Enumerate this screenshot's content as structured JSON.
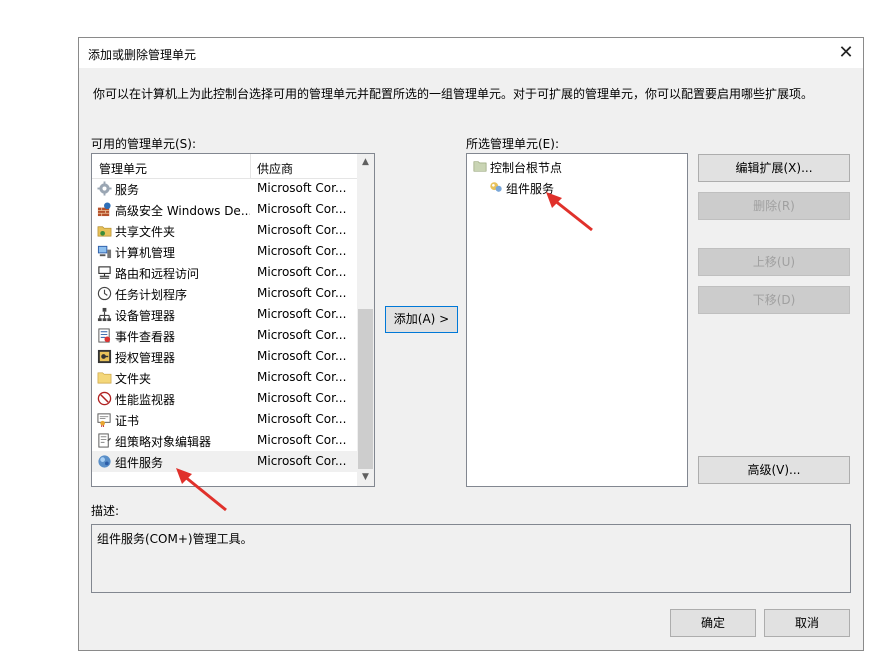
{
  "dialog": {
    "title": "添加或删除管理单元",
    "close_glyph": "✕",
    "intro": "你可以在计算机上为此控制台选择可用的管理单元并配置所选的一组管理单元。对于可扩展的管理单元，你可以配置要启用哪些扩展项。"
  },
  "available": {
    "label": "可用的管理单元(S):",
    "col_name": "管理单元",
    "col_vendor": "供应商",
    "items": [
      {
        "name": "服务",
        "vendor": "Microsoft Cor...",
        "icon": "gear-icon"
      },
      {
        "name": "高级安全 Windows De...",
        "vendor": "Microsoft Cor...",
        "icon": "firewall-icon"
      },
      {
        "name": "共享文件夹",
        "vendor": "Microsoft Cor...",
        "icon": "shared-folder-icon"
      },
      {
        "name": "计算机管理",
        "vendor": "Microsoft Cor...",
        "icon": "computer-management-icon"
      },
      {
        "name": "路由和远程访问",
        "vendor": "Microsoft Cor...",
        "icon": "routing-icon"
      },
      {
        "name": "任务计划程序",
        "vendor": "Microsoft Cor...",
        "icon": "clock-icon"
      },
      {
        "name": "设备管理器",
        "vendor": "Microsoft Cor...",
        "icon": "device-manager-icon"
      },
      {
        "name": "事件查看器",
        "vendor": "Microsoft Cor...",
        "icon": "event-viewer-icon"
      },
      {
        "name": "授权管理器",
        "vendor": "Microsoft Cor...",
        "icon": "authorization-icon"
      },
      {
        "name": "文件夹",
        "vendor": "Microsoft Cor...",
        "icon": "folder-icon"
      },
      {
        "name": "性能监视器",
        "vendor": "Microsoft Cor...",
        "icon": "performance-icon"
      },
      {
        "name": "证书",
        "vendor": "Microsoft Cor...",
        "icon": "certificate-icon"
      },
      {
        "name": "组策略对象编辑器",
        "vendor": "Microsoft Cor...",
        "icon": "group-policy-icon"
      },
      {
        "name": "组件服务",
        "vendor": "Microsoft Cor...",
        "icon": "component-services-icon"
      }
    ]
  },
  "add_button": "添加(A) >",
  "selected": {
    "label": "所选管理单元(E):",
    "root": "控制台根节点",
    "child": "组件服务"
  },
  "side_buttons": {
    "edit_ext": "编辑扩展(X)...",
    "remove": "删除(R)",
    "move_up": "上移(U)",
    "move_down": "下移(D)",
    "advanced": "高级(V)..."
  },
  "description": {
    "label": "描述:",
    "text": "组件服务(COM+)管理工具。"
  },
  "footer": {
    "ok": "确定",
    "cancel": "取消"
  },
  "colors": {
    "annotation_arrow": "#e0312b",
    "dialog_bg": "#f0f0f0",
    "focus_border": "#0078d7"
  }
}
